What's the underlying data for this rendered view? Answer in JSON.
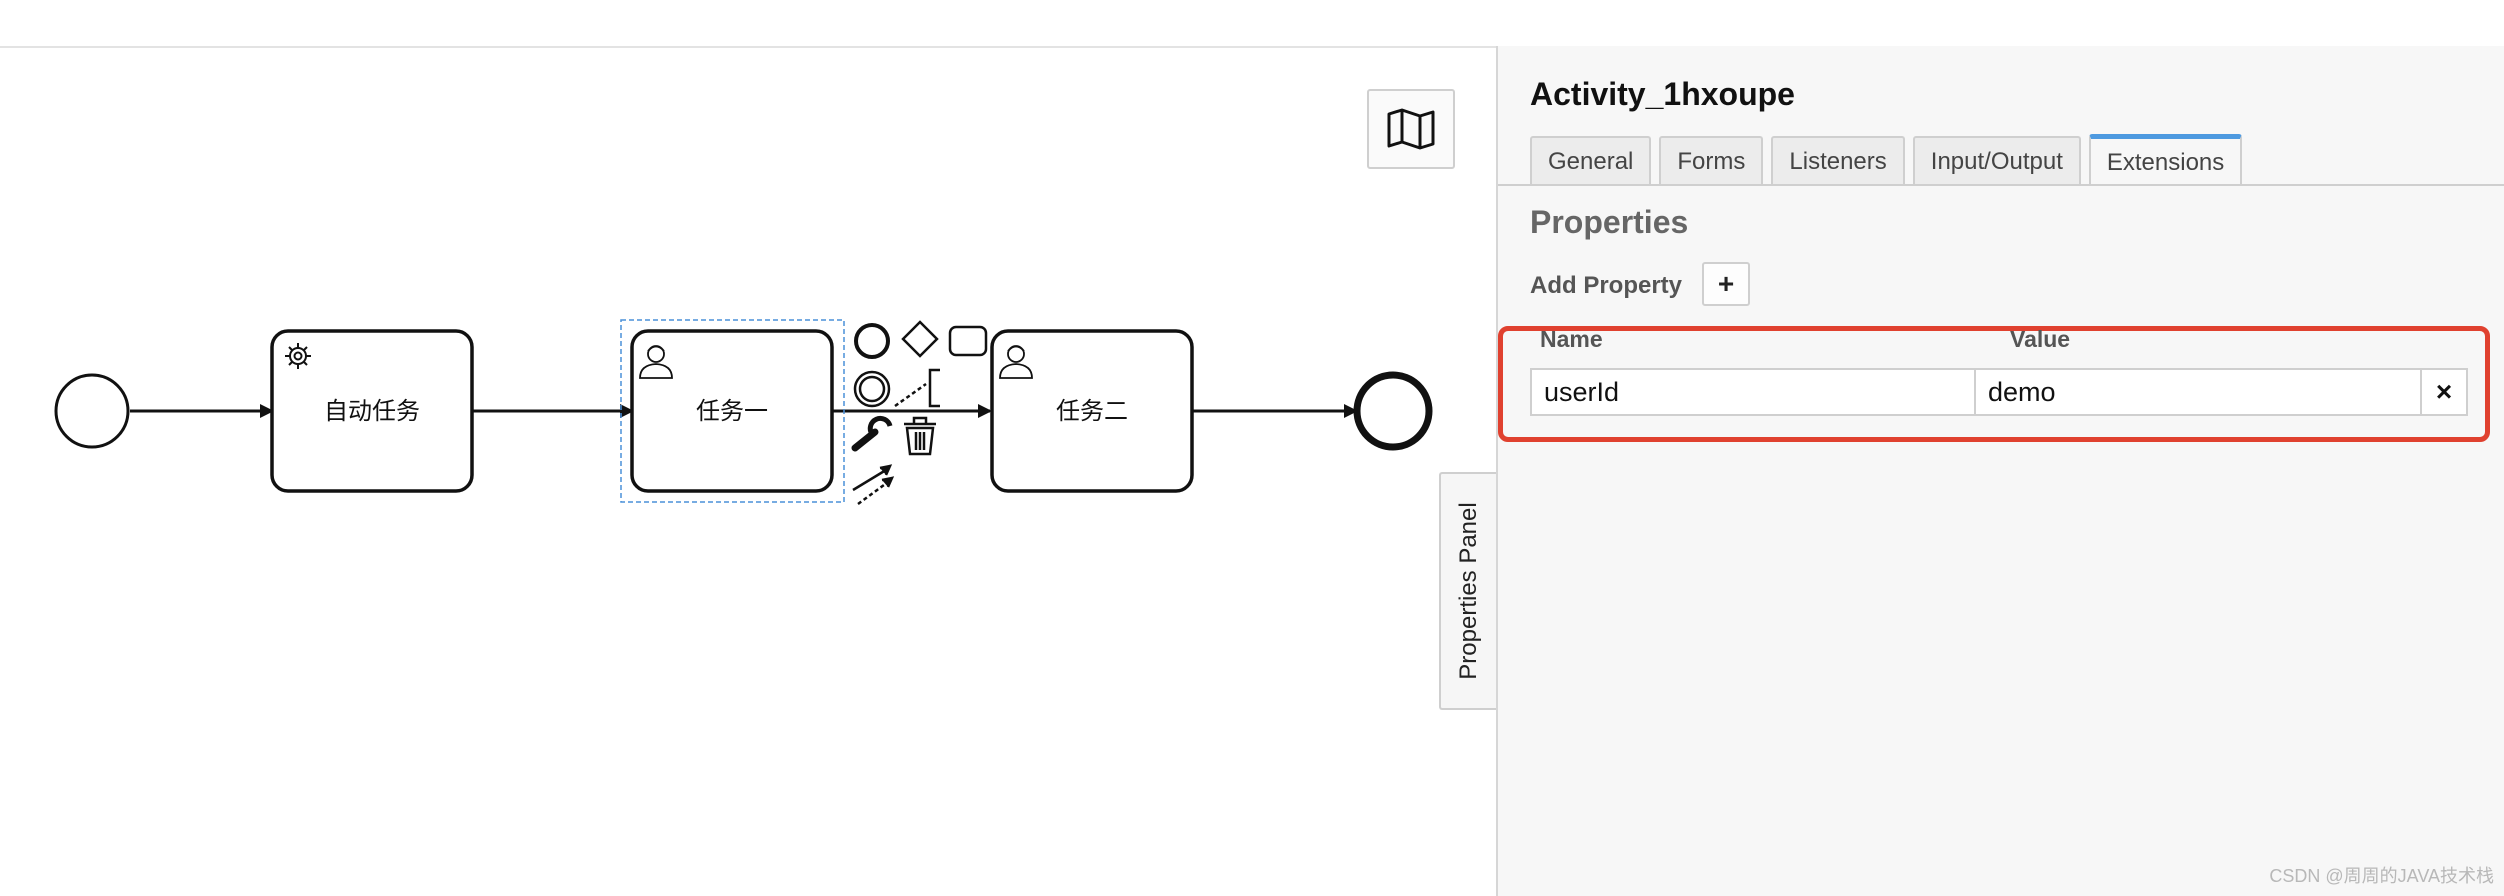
{
  "diagram": {
    "nodes": [
      {
        "id": "start-event",
        "label": ""
      },
      {
        "id": "auto-task",
        "label": "自动任务",
        "icon": "gear-icon"
      },
      {
        "id": "task-one",
        "label": "任务一",
        "icon": "user-icon",
        "selected": true
      },
      {
        "id": "task-two",
        "label": "任务二",
        "icon": "user-icon"
      },
      {
        "id": "end-event",
        "label": ""
      }
    ],
    "context_pad": [
      "intermediate-event-icon",
      "gateway-icon",
      "task-icon",
      "end-event-icon",
      "text-annotation-icon",
      "wrench-icon",
      "trash-icon",
      "connect-icon"
    ],
    "minimap_icon": "map-icon"
  },
  "properties_panel_tab": "Properties Panel",
  "panel": {
    "title": "Activity_1hxoupe",
    "tabs": [
      "General",
      "Forms",
      "Listeners",
      "Input/Output",
      "Extensions"
    ],
    "active_tab": "Extensions",
    "section_title": "Properties",
    "add_property_label": "Add Property",
    "add_button": "+",
    "name_header": "Name",
    "value_header": "Value",
    "property": {
      "name": "userId",
      "value": "demo"
    },
    "delete_button": "×"
  },
  "colors": {
    "highlight": "#e0412f",
    "active_tab_accent": "#4e9ae0",
    "selection": "#4a90d9"
  },
  "watermark": "CSDN @周周的JAVA技术栈"
}
